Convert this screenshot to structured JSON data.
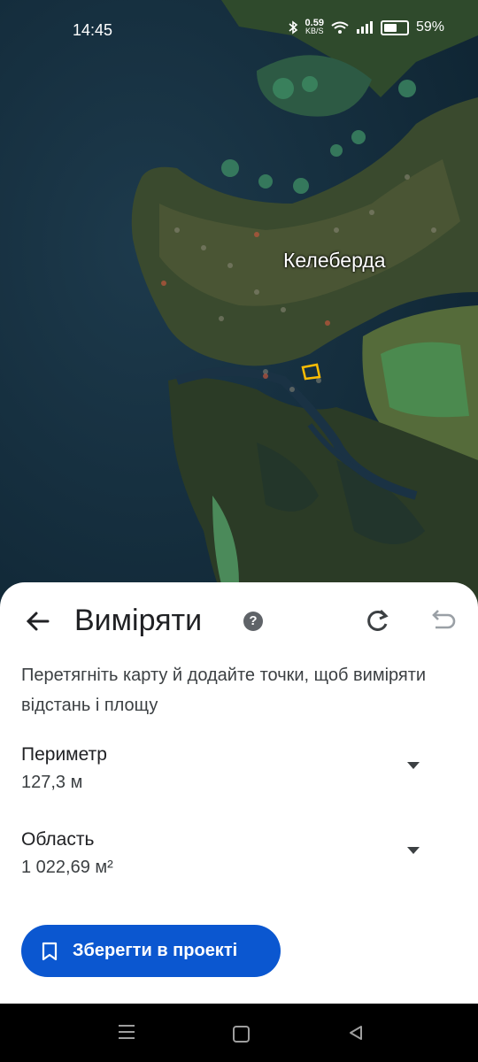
{
  "status_bar": {
    "time": "14:45",
    "net_speed_value": "0.59",
    "net_speed_unit": "KB/S",
    "battery": "59%",
    "battery_level": 0.59,
    "icons": [
      "bluetooth-icon",
      "wifi-icon",
      "signal-icon",
      "battery-icon"
    ]
  },
  "map": {
    "place_label": "Келеберда",
    "selection_color": "#fbbc04"
  },
  "panel": {
    "title": "Виміряти",
    "help_icon": "?",
    "instruction": "Перетягніть карту й додайте точки, щоб виміряти відстань і площу",
    "perimeter_label": "Периметр",
    "perimeter_value": "127,3 м",
    "area_label": "Область",
    "area_value": "1 022,69 м²",
    "save_label": "Зберегти в проекті",
    "accent_color": "#0b57d0"
  },
  "nav_bar": {
    "buttons": [
      "menu-icon",
      "home-icon",
      "back-icon"
    ]
  }
}
